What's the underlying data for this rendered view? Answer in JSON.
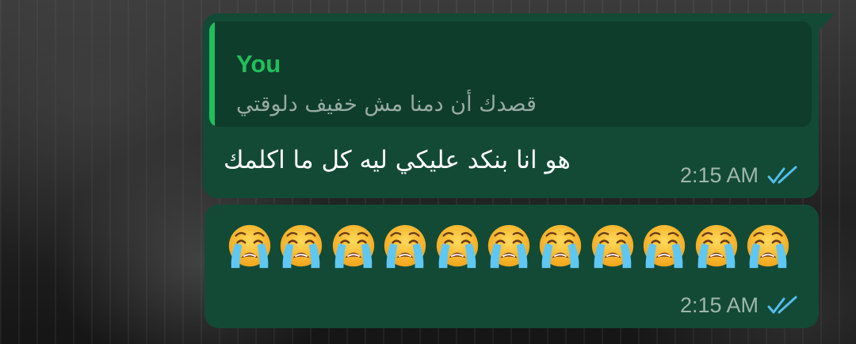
{
  "colors": {
    "bubble": "#134a36",
    "quote_background": "#0f3d2c",
    "quote_accent": "#20bf5e",
    "read_ticks": "#53bdeb"
  },
  "messages": [
    {
      "quote": {
        "sender": "You",
        "text": "قصدك أن دمنا مش خفيف دلوقتي"
      },
      "text": "هو انا بنكد عليكي ليه كل ما اكلمك",
      "time": "2:15 AM",
      "status_icon": "double-check-read-icon"
    },
    {
      "emoji": [
        "😭",
        "😭",
        "😭",
        "😭",
        "😭",
        "😭",
        "😭",
        "😭",
        "😭",
        "😭",
        "😭"
      ],
      "emoji_icon": "loudly-crying-face-icon",
      "time": "2:15 AM",
      "status_icon": "double-check-read-icon"
    }
  ]
}
